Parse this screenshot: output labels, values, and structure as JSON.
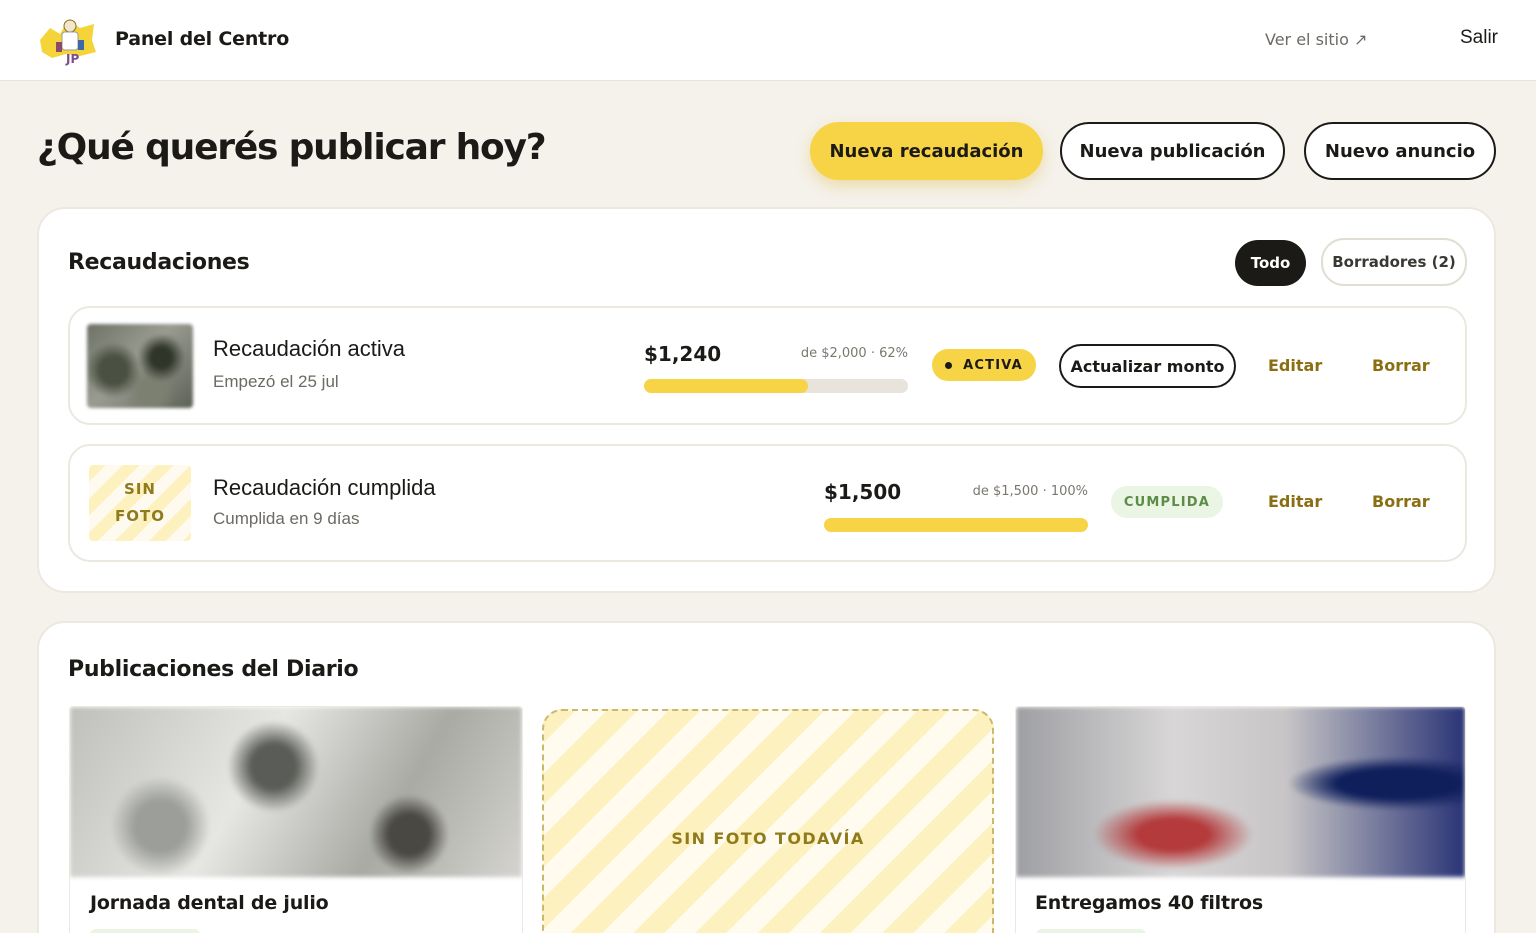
{
  "header": {
    "brand": "Panel del Centro",
    "view_site": "Ver el sitio ↗",
    "logout": "Salir",
    "logo_alt": "logo"
  },
  "hero": {
    "title": "¿Qué querés publicar hoy?",
    "buttons": {
      "new_fundraiser": "Nueva recaudación",
      "new_post": "Nueva publicación",
      "new_ad": "Nuevo anuncio"
    }
  },
  "fundraisers": {
    "title": "Recaudaciones",
    "filters": {
      "all": "Todo",
      "drafts": "Borradores (2)"
    },
    "items": [
      {
        "title": "Recaudación activa",
        "subtitle": "Empezó el 25 jul",
        "amount": "$1,240",
        "goal": "de $2,000 · 62%",
        "progress_percent": 62,
        "status": "ACTIVA",
        "update_label": "Actualizar monto",
        "edit_label": "Editar",
        "delete_label": "Borrar"
      },
      {
        "title": "Recaudación cumplida",
        "subtitle": "Cumplida en 9 días",
        "thumb_line1": "SIN",
        "thumb_line2": "FOTO",
        "amount": "$1,500",
        "goal": "de $1,500 · 100%",
        "progress_percent": 100,
        "status": "CUMPLIDA",
        "edit_label": "Editar",
        "delete_label": "Borrar"
      }
    ]
  },
  "diary": {
    "title": "Publicaciones del Diario",
    "posts": [
      {
        "title": "Jornada dental de julio"
      },
      {
        "no_photo_label": "SIN FOTO TODAVÍA"
      },
      {
        "title": "Entregamos 40 filtros"
      }
    ]
  },
  "colors": {
    "accent": "#f7d446",
    "background": "#f5f2ec",
    "text": "#1c1a17",
    "action_link": "#8a6f12",
    "done_badge_bg": "#eaf5e4",
    "done_badge_text": "#5d8b48"
  }
}
